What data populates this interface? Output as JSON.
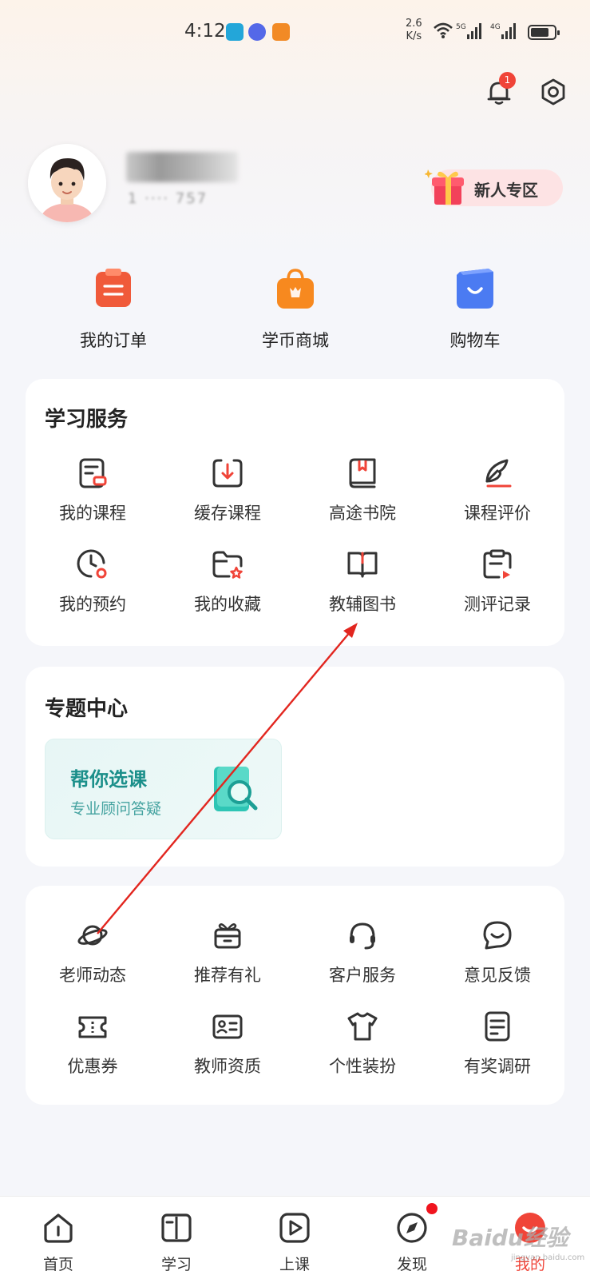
{
  "status_bar": {
    "time": "4:12",
    "speed_top": "2.6",
    "speed_bottom": "K/s",
    "net1": "5G",
    "net2": "4G"
  },
  "header": {
    "notification_count": "1"
  },
  "profile": {
    "user_id_masked": "1 ···· 757"
  },
  "newbie_zone": {
    "label": "新人专区"
  },
  "quick_actions": [
    {
      "label": "我的订单",
      "icon": "order-icon",
      "color": "#f05a3a"
    },
    {
      "label": "学币商城",
      "icon": "shop-bag-icon",
      "color": "#f7891f"
    },
    {
      "label": "购物车",
      "icon": "cart-icon",
      "color": "#4b7bf2"
    }
  ],
  "study_services": {
    "title": "学习服务",
    "items": [
      {
        "label": "我的课程",
        "icon": "course-icon"
      },
      {
        "label": "缓存课程",
        "icon": "download-icon"
      },
      {
        "label": "高途书院",
        "icon": "book-bookmark-icon"
      },
      {
        "label": "课程评价",
        "icon": "feather-pen-icon"
      },
      {
        "label": "我的预约",
        "icon": "clock-icon"
      },
      {
        "label": "我的收藏",
        "icon": "folder-star-icon"
      },
      {
        "label": "教辅图书",
        "icon": "open-book-icon"
      },
      {
        "label": "测评记录",
        "icon": "clipboard-icon"
      }
    ]
  },
  "topic_center": {
    "title": "专题中心",
    "card_title": "帮你选课",
    "card_subtitle": "专业顾问答疑"
  },
  "more_services": {
    "items": [
      {
        "label": "老师动态",
        "icon": "planet-icon"
      },
      {
        "label": "推荐有礼",
        "icon": "gift-icon"
      },
      {
        "label": "客户服务",
        "icon": "headset-icon"
      },
      {
        "label": "意见反馈",
        "icon": "chat-smile-icon"
      },
      {
        "label": "优惠券",
        "icon": "coupon-icon"
      },
      {
        "label": "教师资质",
        "icon": "id-card-icon"
      },
      {
        "label": "个性装扮",
        "icon": "tshirt-icon"
      },
      {
        "label": "有奖调研",
        "icon": "survey-icon"
      }
    ]
  },
  "bottom_nav": [
    {
      "label": "首页",
      "icon": "home-icon"
    },
    {
      "label": "学习",
      "icon": "study-book-icon"
    },
    {
      "label": "上课",
      "icon": "play-icon"
    },
    {
      "label": "发现",
      "icon": "compass-icon"
    },
    {
      "label": "我的",
      "icon": "profile-face-icon",
      "active": true
    }
  ],
  "colors": {
    "accent_red": "#f04438",
    "arrow_red": "#e2261f",
    "teal": "#1b8f8a"
  },
  "watermark": {
    "text": "Baidu经验",
    "sub": "jingyan.baidu.com"
  }
}
